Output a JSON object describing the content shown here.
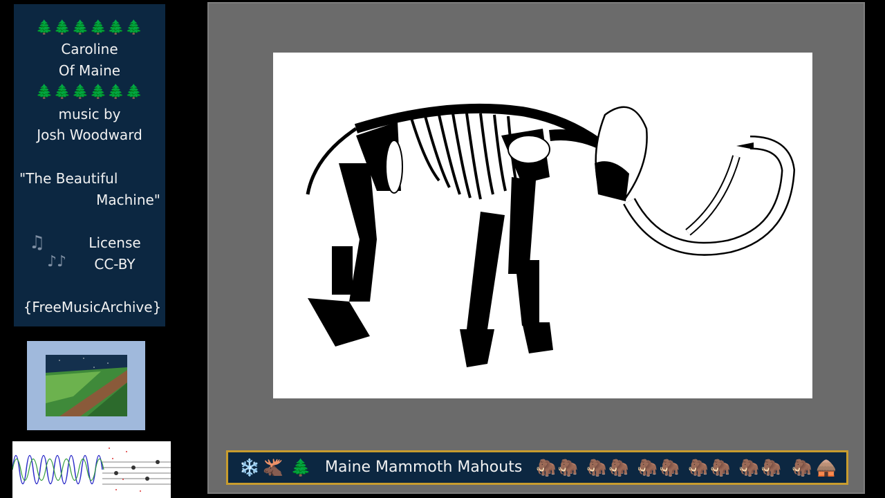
{
  "info": {
    "trees_top": "🌲🌲🌲🌲🌲🌲",
    "title_line1": "Caroline",
    "title_line2": "Of Maine",
    "trees_bottom": "🌲🌲🌲🌲🌲🌲",
    "music_by": "music by",
    "artist": "Josh Woodward",
    "song_line1": "\"The Beautiful",
    "song_line2": "Machine\"",
    "note1": "♫",
    "note2": "♪♪",
    "license_label": "License",
    "license_value": "CC-BY",
    "source": "{FreeMusicArchive}"
  },
  "banner": {
    "title": "Maine Mammoth Mahouts",
    "left_icons": [
      "snowflake-icon",
      "moose-icon",
      "tree-icon"
    ],
    "right_icons": [
      "mammoth-icon",
      "hut-icon"
    ]
  },
  "colors": {
    "panel_bg": "#0c2741",
    "banner_border": "#c89c2e",
    "stage_bg": "#6b6b6b"
  }
}
